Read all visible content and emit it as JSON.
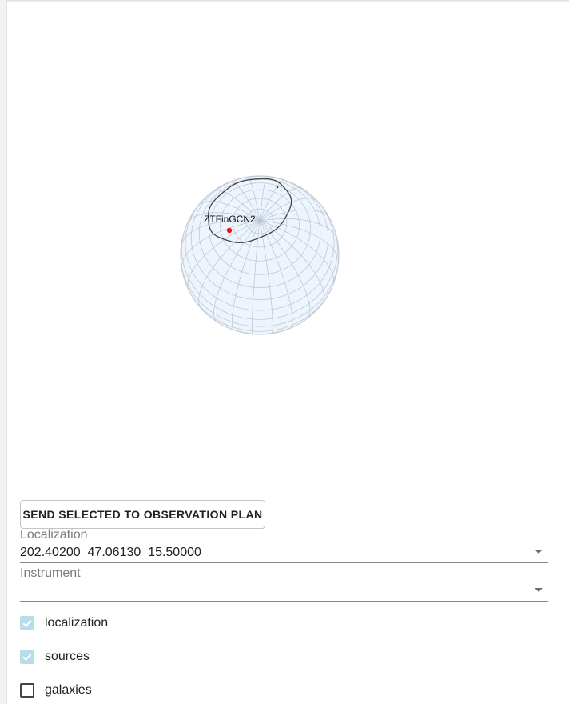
{
  "globe": {
    "source_label": "ZTFinGCN2",
    "colors": {
      "sphere_fill": "#eef4fc",
      "grid": "#b6c4d6",
      "outline": "#c8ccd2",
      "localization_contour": "#444444",
      "source_marker": "#ee1111"
    }
  },
  "actions": {
    "send_to_plan_label": "SEND SELECTED TO OBSERVATION PLAN"
  },
  "localization": {
    "label": "Localization",
    "value": "202.40200_47.06130_15.50000"
  },
  "instrument": {
    "label": "Instrument",
    "value": ""
  },
  "layers": [
    {
      "label": "localization",
      "checked": true
    },
    {
      "label": "sources",
      "checked": true
    },
    {
      "label": "galaxies",
      "checked": false
    }
  ]
}
